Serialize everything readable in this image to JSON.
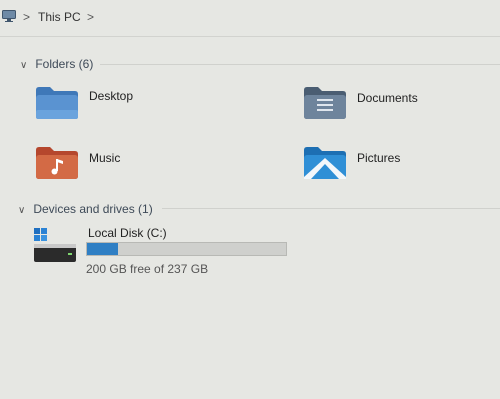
{
  "addressbar": {
    "icon": "computer-icon",
    "location": "This PC",
    "separator": ">"
  },
  "folders_group": {
    "title": "Folders (6)",
    "items": [
      {
        "label": "Desktop",
        "icon": "desktop-folder-icon",
        "color": "#4f86c6"
      },
      {
        "label": "Documents",
        "icon": "documents-folder-icon",
        "color": "#5a6f87"
      },
      {
        "label": "Music",
        "icon": "music-folder-icon",
        "color": "#c65a3a"
      },
      {
        "label": "Pictures",
        "icon": "pictures-folder-icon",
        "color": "#2b86c8"
      }
    ]
  },
  "drives_group": {
    "title": "Devices and drives (1)",
    "drives": [
      {
        "name": "Local Disk (C:)",
        "icon": "windows-drive-icon",
        "free_text": "200 GB free of 237 GB",
        "used_fraction": 0.156,
        "bar_color": "#2f7fc4"
      }
    ]
  }
}
